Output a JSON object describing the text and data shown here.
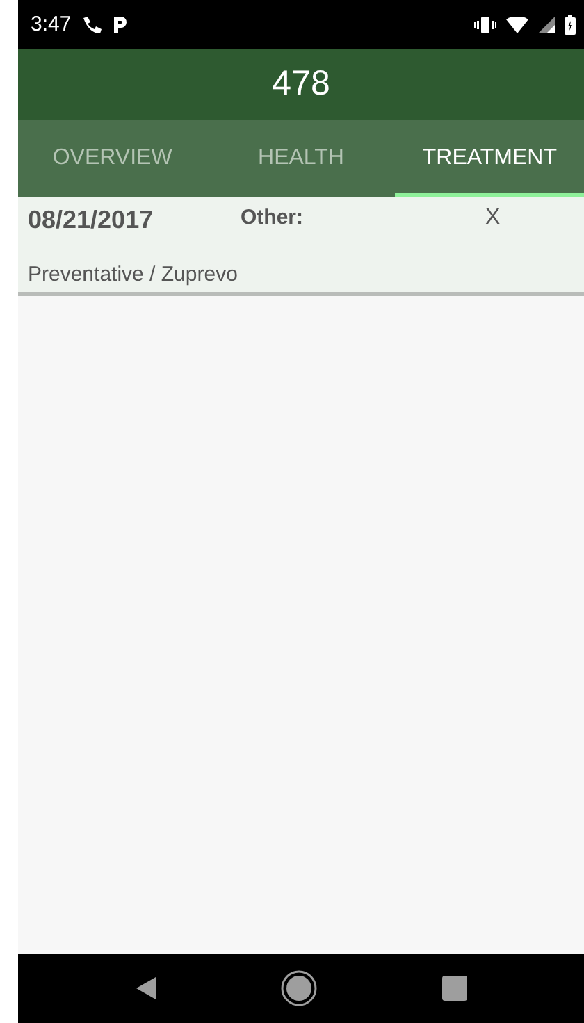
{
  "status_bar": {
    "time": "3:47"
  },
  "title": "478",
  "tabs": [
    {
      "label": "OVERVIEW",
      "selected": false
    },
    {
      "label": "HEALTH",
      "selected": false
    },
    {
      "label": "TREATMENT",
      "selected": true
    }
  ],
  "treatments": [
    {
      "date": "08/21/2017",
      "type_label": "Other:",
      "column_3": "X",
      "description": "Preventative / Zuprevo"
    }
  ]
}
